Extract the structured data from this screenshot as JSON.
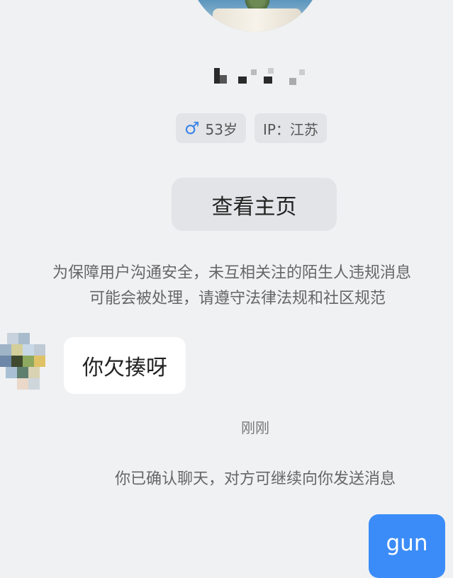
{
  "profile": {
    "nickname": "",
    "gender_icon": "male-icon",
    "gender_symbol": "♂",
    "age": "53岁",
    "ip_location": "IP：江苏",
    "view_home_label": "查看主页"
  },
  "notice": {
    "line1": "为保障用户沟通安全，未互相关注的陌生人违规消息",
    "line2": "可能会被处理，请遵守法律法规和社区规范"
  },
  "messages": [
    {
      "direction": "incoming",
      "text": "你欠揍呀"
    },
    {
      "direction": "outgoing",
      "text": "gun"
    }
  ],
  "timestamp": "刚刚",
  "system_message": "你已确认聊天，对方可继续向你发送消息",
  "colors": {
    "background": "#f0f1f3",
    "tag_bg": "#e3e4e7",
    "accent_blue": "#3b8cf8",
    "gender_blue": "#3a83e8"
  }
}
